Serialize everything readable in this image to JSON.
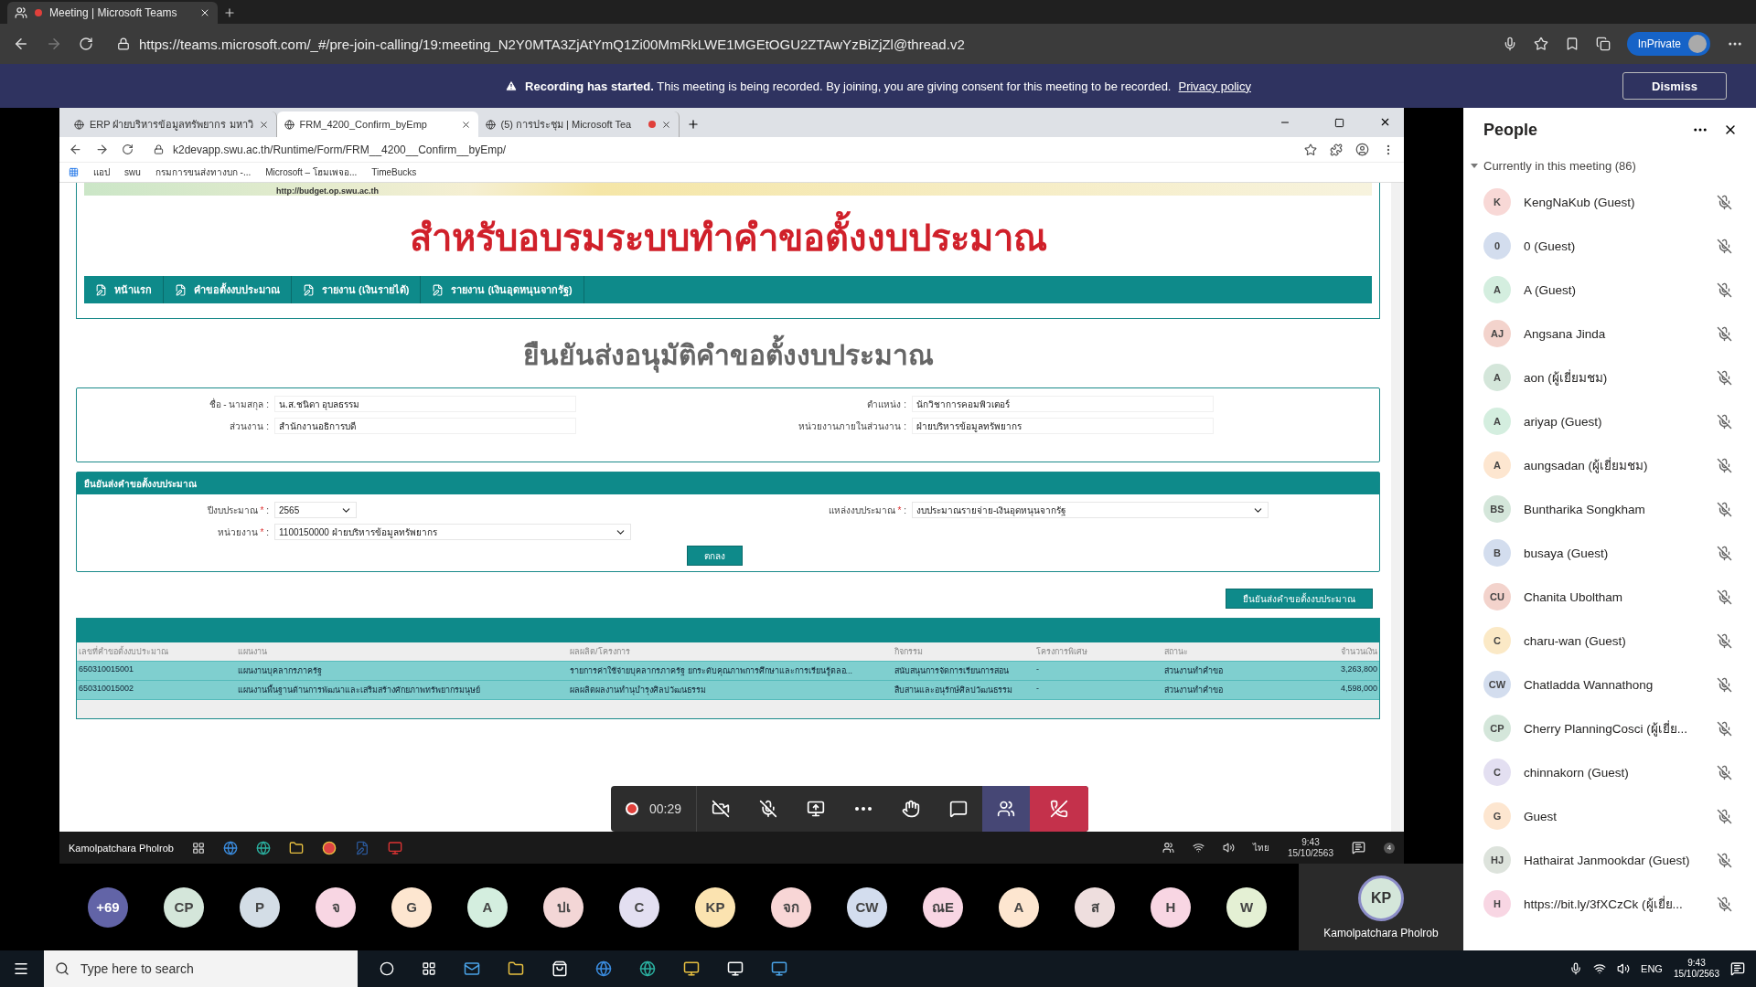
{
  "browser": {
    "tab": {
      "title": "Meeting | Microsoft Teams",
      "recording": true
    },
    "url": "https://teams.microsoft.com/_#/pre-join-calling/19:meeting_N2Y0MTA3ZjAtYmQ1Zi00MmRkLWE1MGEtOGU2ZTAwYzBiZjZl@thread.v2",
    "profile": "InPrivate"
  },
  "recording_banner": {
    "message": "**Recording has started.** This meeting is being recorded. By joining, you are giving consent for this meeting to be recorded.",
    "link": "Privacy policy",
    "button": "Dismiss"
  },
  "shared_screen": {
    "presenter": "Kamolpatchara Pholrob",
    "browser_tabs": [
      {
        "title": "ERP ฝ่ายบริหารข้อมูลทรัพยากร มหาวิ",
        "selected": false,
        "recording": false
      },
      {
        "title": "FRM_4200_Confirm_byEmp",
        "selected": true,
        "recording": false
      },
      {
        "title": "(5) การประชุม | Microsoft Tea",
        "selected": false,
        "recording": true
      }
    ],
    "url": "k2devapp.swu.ac.th/Runtime/Form/FRM__4200__Confirm__byEmp/",
    "bookmarks": [
      "แอป",
      "swu",
      "กรมการขนส่งทางบก -...",
      "Microsoft – โฮมเพจอ...",
      "TimeBucks"
    ],
    "page": {
      "banner_url": "http://budget.op.swu.ac.th",
      "site_title": "สำหรับอบรมระบบทำคำขอตั้งงบประมาณ",
      "nav": [
        "หน้าแรก",
        "คำขอตั้งงบประมาณ",
        "รายงาน (เงินรายได้)",
        "รายงาน (เงินอุดหนุนจากรัฐ)"
      ],
      "title": "ยืนยันส่งอนุมัติคำขอตั้งงบประมาณ",
      "profile_fields": [
        {
          "label": "ชื่อ - นามสกุล :",
          "value": "น.ส.ชนิดา  อุบลธรรม"
        },
        {
          "label": "ตำแหน่ง :",
          "value": "นักวิชาการคอมพิวเตอร์"
        },
        {
          "label": "ส่วนงาน :",
          "value": "สำนักงานอธิการบดี"
        },
        {
          "label": "หน่วยงานภายในส่วนงาน :",
          "value": "ฝ่ายบริหารข้อมูลทรัพยากร"
        }
      ],
      "section": {
        "title": "ยืนยันส่งคำขอตั้งงบประมาณ",
        "fields": [
          {
            "label": "ปีงบประมาณ",
            "mark": "*",
            "separator": ":",
            "value": "2565",
            "kind": "short"
          },
          {
            "label": "แหล่งงบประมาณ",
            "mark": "*",
            "separator": ":",
            "value": "งบประมาณรายจ่าย-เงินอุดหนุนจากรัฐ",
            "kind": "long"
          },
          {
            "label": "หน่วยงาน",
            "mark": "*",
            "separator": ":",
            "value": "1100150000 ฝ่ายบริหารข้อมูลทรัพยากร",
            "kind": "long"
          }
        ],
        "button": "ตกลง"
      },
      "confirm_button": "ยืนยันส่งคำขอตั้งงบประมาณ",
      "table": {
        "columns": [
          "เลขที่คำขอตั้งงบประมาณ",
          "แผนงาน",
          "ผลผลิต/โครงการ",
          "กิจกรรม",
          "โครงการพิเศษ",
          "สถานะ",
          "จำนวนเงิน"
        ],
        "rows": [
          {
            "selected": true,
            "cells": [
              "650310015001",
              "แผนงานบุคลากรภาครัฐ",
              "รายการค่าใช้จ่ายบุคลากรภาครัฐ ยกระดับคุณภาพการศึกษาและการเรียนรู้ตลอ...",
              "สนับสนุนการจัดการเรียนการสอน",
              "-",
              "ส่วนงานทำคำขอ",
              "3,263,800"
            ]
          },
          {
            "selected": true,
            "cells": [
              "650310015002",
              "แผนงานพื้นฐานด้านการพัฒนาและเสริมสร้างศักยภาพทรัพยากรมนุษย์",
              "ผลผลิตผลงานทำนุบำรุงศิลปวัฒนธรรม",
              "สืบสานและอนุรักษ์ศิลปวัฒนธรรม",
              "-",
              "ส่วนงานทำคำขอ",
              "4,598,000"
            ]
          }
        ]
      }
    },
    "taskbar": {
      "language": "ไทย",
      "time": "9:43",
      "date": "15/10/2563",
      "notifications": "4"
    }
  },
  "call_controls": {
    "timer": "00:29",
    "recording": true,
    "buttons": [
      {
        "kind": "camera",
        "selected": false
      },
      {
        "kind": "mic",
        "selected": false
      },
      {
        "kind": "share",
        "selected": false
      },
      {
        "kind": "more",
        "selected": false
      },
      {
        "kind": "hand",
        "selected": false
      },
      {
        "kind": "chat",
        "selected": false
      },
      {
        "kind": "people",
        "selected": true
      },
      {
        "kind": "hangup",
        "selected": false
      }
    ]
  },
  "participants": [
    {
      "initials": "+69",
      "kind": "overflow",
      "color": "#6264a7"
    },
    {
      "initials": "CP",
      "kind": "person",
      "color": "#d4e6da"
    },
    {
      "initials": "P",
      "kind": "person",
      "color": "#d3dde6"
    },
    {
      "initials": "จ",
      "kind": "person",
      "color": "#f8d6e3"
    },
    {
      "initials": "G",
      "kind": "person",
      "color": "#fde6d0"
    },
    {
      "initials": "A",
      "kind": "person",
      "color": "#d4eedf"
    },
    {
      "initials": "ปเ",
      "kind": "person",
      "color": "#f3d6d6"
    },
    {
      "initials": "C",
      "kind": "person",
      "color": "#e3dff1"
    },
    {
      "initials": "KP",
      "kind": "person",
      "color": "#fbe3b0"
    },
    {
      "initials": "จก",
      "kind": "person",
      "color": "#f8d6d6"
    },
    {
      "initials": "CW",
      "kind": "person",
      "color": "#d3ddee"
    },
    {
      "initials": "ณE",
      "kind": "person",
      "color": "#f8d6e3"
    },
    {
      "initials": "A",
      "kind": "person",
      "color": "#fde6d0"
    },
    {
      "initials": "ส",
      "kind": "person",
      "color": "#eedede"
    },
    {
      "initials": "H",
      "kind": "person",
      "color": "#f8d6e3"
    },
    {
      "initials": "W",
      "kind": "person",
      "color": "#e4f0d4"
    }
  ],
  "self_view": {
    "initials": "KP",
    "name": "Kamolpatchara Pholrob"
  },
  "people_panel": {
    "title": "People",
    "section": "Currently in this meeting (86)",
    "expanded": true,
    "people": [
      {
        "initials": "K",
        "name": "KengNaKub (Guest)",
        "color": "#f8d8d6",
        "muted": true
      },
      {
        "initials": "0",
        "name": "0 (Guest)",
        "color": "#d3ddee",
        "muted": true
      },
      {
        "initials": "A",
        "name": "A (Guest)",
        "color": "#d4eedf",
        "muted": true
      },
      {
        "initials": "AJ",
        "name": "Angsana Jinda",
        "color": "#f3d3cc",
        "muted": true
      },
      {
        "initials": "A",
        "name": "aon (ผู้เยี่ยมชม)",
        "color": "#d4e6da",
        "muted": true
      },
      {
        "initials": "A",
        "name": "ariyap (Guest)",
        "color": "#d4eedf",
        "muted": true
      },
      {
        "initials": "A",
        "name": "aungsadan (ผู้เยี่ยมชม)",
        "color": "#fde6d0",
        "muted": true
      },
      {
        "initials": "BS",
        "name": "Buntharika Songkham",
        "color": "#d4e6da",
        "muted": true
      },
      {
        "initials": "B",
        "name": "busaya (Guest)",
        "color": "#d3ddee",
        "muted": true
      },
      {
        "initials": "CU",
        "name": "Chanita Uboltham",
        "color": "#f3d3cc",
        "muted": true
      },
      {
        "initials": "C",
        "name": "charu-wan (Guest)",
        "color": "#fbe9c6",
        "muted": true
      },
      {
        "initials": "CW",
        "name": "Chatladda Wannathong",
        "color": "#d3ddee",
        "muted": true
      },
      {
        "initials": "CP",
        "name": "Cherry PlanningCosci (ผู้เยี่ย...",
        "color": "#d4e6da",
        "muted": true
      },
      {
        "initials": "C",
        "name": "chinnakorn (Guest)",
        "color": "#e3dff1",
        "muted": true
      },
      {
        "initials": "G",
        "name": "Guest",
        "color": "#fde6d0",
        "muted": true
      },
      {
        "initials": "HJ",
        "name": "Hathairat Janmookdar (Guest)",
        "color": "#dde3dc",
        "muted": true
      },
      {
        "initials": "H",
        "name": "https://bit.ly/3fXCzCk (ผู้เยี่ย...",
        "color": "#f8d6e3",
        "muted": true
      }
    ]
  },
  "taskbar": {
    "search_placeholder": "Type here to search",
    "language": "ENG",
    "time": "9:43",
    "date": "15/10/2563"
  }
}
